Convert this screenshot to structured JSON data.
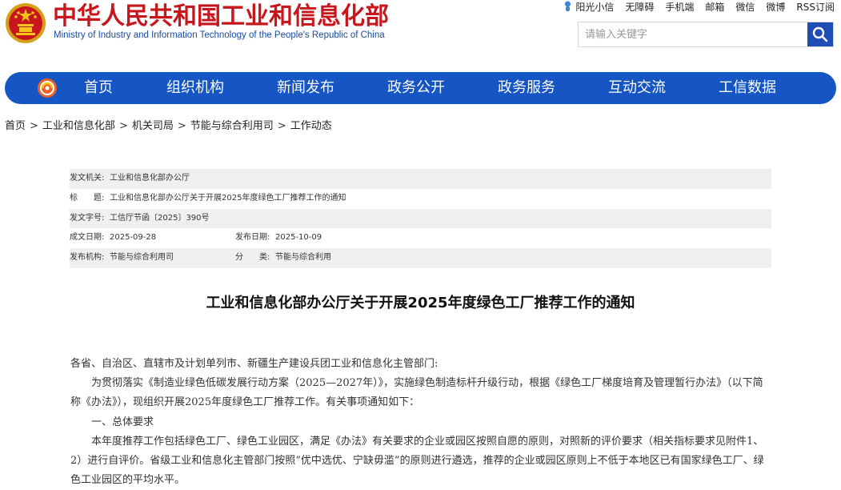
{
  "header": {
    "title_cn": "中华人民共和国工业和信息化部",
    "title_en": "Ministry of Industry and Information Technology of the People's Republic of China",
    "emblem_icon": "national-emblem-icon",
    "top_links": [
      "阳光小信",
      "无障碍",
      "手机端",
      "邮箱",
      "微信",
      "微博",
      "RSS订阅"
    ],
    "search": {
      "placeholder": "请输入关键字",
      "value": ""
    }
  },
  "nav": {
    "logo_icon": "miit-logo-icon",
    "items": [
      "首页",
      "组织机构",
      "新闻发布",
      "政务公开",
      "政务服务",
      "互动交流",
      "工信数据"
    ]
  },
  "breadcrumb": [
    "首页",
    "工业和信息化部",
    "机关司局",
    "节能与综合利用司",
    "工作动态"
  ],
  "meta": {
    "issuer_label": "发文机关:",
    "issuer": "工业和信息化部办公厅",
    "subject_label": "标　　题:",
    "subject": "工业和信息化部办公厅关于开展2025年度绿色工厂推荐工作的通知",
    "docno_label": "发文字号:",
    "docno": "工信厅节函〔2025〕390号",
    "created_label": "成文日期:",
    "created": "2025-09-28",
    "published_label": "发布日期:",
    "published": "2025-10-09",
    "org_label": "发布机构:",
    "org": "节能与综合利用司",
    "category_label": "分　　类:",
    "category": "节能与综合利用"
  },
  "article": {
    "title": "工业和信息化部办公厅关于开展2025年度绿色工厂推荐工作的通知",
    "salutation": "各省、自治区、直辖市及计划单列市、新疆生产建设兵团工业和信息化主管部门:",
    "para1": "为贯彻落实《制造业绿色低碳发展行动方案（2025—2027年）》，实施绿色制造标杆升级行动，根据《绿色工厂梯度培育及管理暂行办法》（以下简称《办法》），现组织开展2025年度绿色工厂推荐工作。有关事项通知如下：",
    "section1": "一、总体要求",
    "para2": "本年度推荐工作包括绿色工厂、绿色工业园区，满足《办法》有关要求的企业或园区按照自愿的原则，对照新的评价要求（相关指标要求见附件1、2）进行自评价。省级工业和信息化主管部门按照“优中选优、宁缺毋滥”的原则进行遴选，推荐的企业或园区原则上不低于本地区已有国家绿色工厂、绿色工业园区的平均水平。"
  }
}
